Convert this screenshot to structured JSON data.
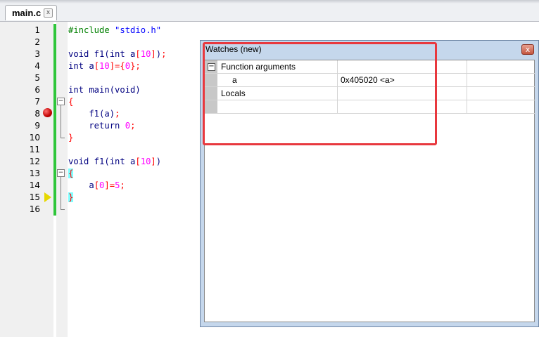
{
  "tabs": [
    {
      "label": "main.c",
      "close": "x"
    }
  ],
  "editor": {
    "lines": [
      {
        "num": "1",
        "code": "#include \"stdio.h\""
      },
      {
        "num": "2",
        "code": ""
      },
      {
        "num": "3",
        "code": "void f1(int a[10]);"
      },
      {
        "num": "4",
        "code": "int a[10]={0};"
      },
      {
        "num": "5",
        "code": ""
      },
      {
        "num": "6",
        "code": "int main(void)"
      },
      {
        "num": "7",
        "code": "{"
      },
      {
        "num": "8",
        "code": "    f1(a);"
      },
      {
        "num": "9",
        "code": "    return 0;"
      },
      {
        "num": "10",
        "code": "}"
      },
      {
        "num": "11",
        "code": ""
      },
      {
        "num": "12",
        "code": "void f1(int a[10])"
      },
      {
        "num": "13",
        "code": "{"
      },
      {
        "num": "14",
        "code": "    a[0]=5;"
      },
      {
        "num": "15",
        "code": "}"
      },
      {
        "num": "16",
        "code": ""
      }
    ],
    "breakpoint_line": "8",
    "current_line": "15"
  },
  "watches": {
    "title": "Watches (new)",
    "close": "x",
    "expand_symbol": "−",
    "rows": [
      {
        "name": "Function arguments",
        "value": "",
        "type": ""
      },
      {
        "name": "a",
        "value": "0x405020 <a>",
        "type": ""
      },
      {
        "name": "Locals",
        "value": "",
        "type": ""
      },
      {
        "name": "",
        "value": "",
        "type": ""
      }
    ]
  },
  "colors": {
    "changebar": "#2ec63a",
    "breakpoint": "#c00000",
    "current_line_arrow": "#e6d800",
    "highlight_annotation": "#e8383e",
    "keyword": "#000080",
    "number": "#ff00ff",
    "string": "#0000ff",
    "preprocessor": "#008000"
  }
}
